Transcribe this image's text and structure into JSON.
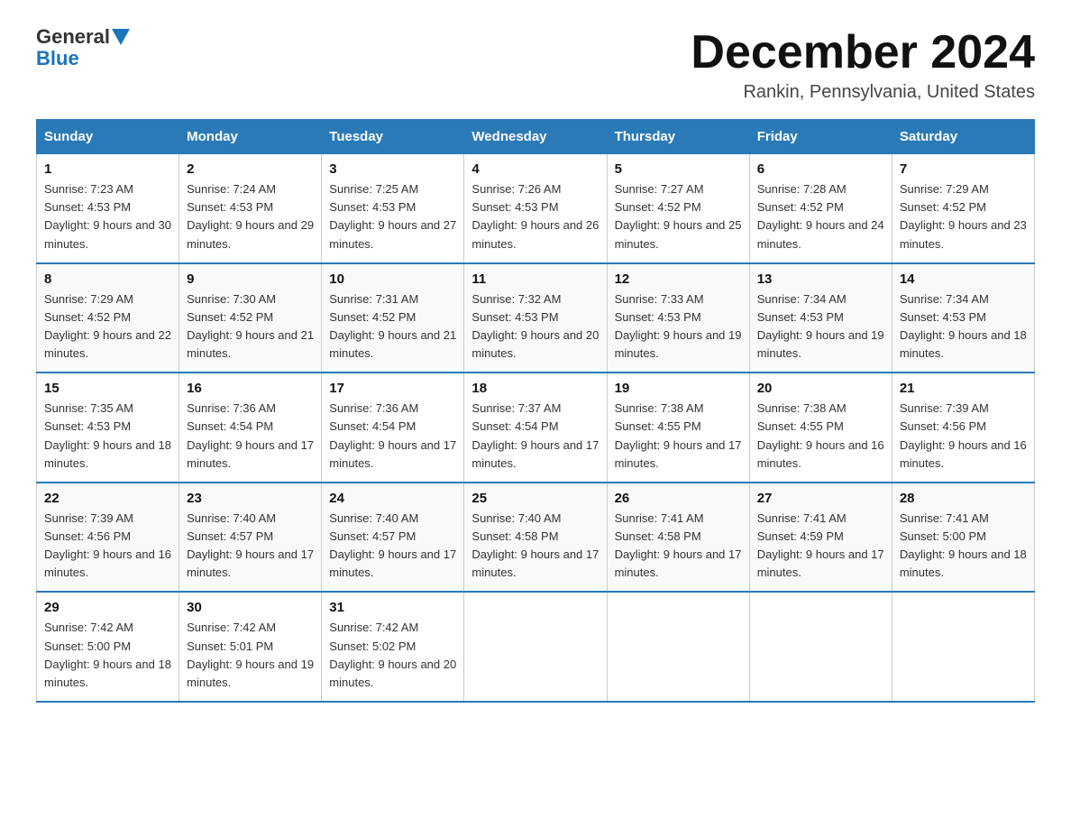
{
  "logo": {
    "general": "General",
    "blue": "Blue"
  },
  "title": "December 2024",
  "location": "Rankin, Pennsylvania, United States",
  "days_of_week": [
    "Sunday",
    "Monday",
    "Tuesday",
    "Wednesday",
    "Thursday",
    "Friday",
    "Saturday"
  ],
  "weeks": [
    [
      {
        "day": "1",
        "sunrise": "7:23 AM",
        "sunset": "4:53 PM",
        "daylight": "9 hours and 30 minutes."
      },
      {
        "day": "2",
        "sunrise": "7:24 AM",
        "sunset": "4:53 PM",
        "daylight": "9 hours and 29 minutes."
      },
      {
        "day": "3",
        "sunrise": "7:25 AM",
        "sunset": "4:53 PM",
        "daylight": "9 hours and 27 minutes."
      },
      {
        "day": "4",
        "sunrise": "7:26 AM",
        "sunset": "4:53 PM",
        "daylight": "9 hours and 26 minutes."
      },
      {
        "day": "5",
        "sunrise": "7:27 AM",
        "sunset": "4:52 PM",
        "daylight": "9 hours and 25 minutes."
      },
      {
        "day": "6",
        "sunrise": "7:28 AM",
        "sunset": "4:52 PM",
        "daylight": "9 hours and 24 minutes."
      },
      {
        "day": "7",
        "sunrise": "7:29 AM",
        "sunset": "4:52 PM",
        "daylight": "9 hours and 23 minutes."
      }
    ],
    [
      {
        "day": "8",
        "sunrise": "7:29 AM",
        "sunset": "4:52 PM",
        "daylight": "9 hours and 22 minutes."
      },
      {
        "day": "9",
        "sunrise": "7:30 AM",
        "sunset": "4:52 PM",
        "daylight": "9 hours and 21 minutes."
      },
      {
        "day": "10",
        "sunrise": "7:31 AM",
        "sunset": "4:52 PM",
        "daylight": "9 hours and 21 minutes."
      },
      {
        "day": "11",
        "sunrise": "7:32 AM",
        "sunset": "4:53 PM",
        "daylight": "9 hours and 20 minutes."
      },
      {
        "day": "12",
        "sunrise": "7:33 AM",
        "sunset": "4:53 PM",
        "daylight": "9 hours and 19 minutes."
      },
      {
        "day": "13",
        "sunrise": "7:34 AM",
        "sunset": "4:53 PM",
        "daylight": "9 hours and 19 minutes."
      },
      {
        "day": "14",
        "sunrise": "7:34 AM",
        "sunset": "4:53 PM",
        "daylight": "9 hours and 18 minutes."
      }
    ],
    [
      {
        "day": "15",
        "sunrise": "7:35 AM",
        "sunset": "4:53 PM",
        "daylight": "9 hours and 18 minutes."
      },
      {
        "day": "16",
        "sunrise": "7:36 AM",
        "sunset": "4:54 PM",
        "daylight": "9 hours and 17 minutes."
      },
      {
        "day": "17",
        "sunrise": "7:36 AM",
        "sunset": "4:54 PM",
        "daylight": "9 hours and 17 minutes."
      },
      {
        "day": "18",
        "sunrise": "7:37 AM",
        "sunset": "4:54 PM",
        "daylight": "9 hours and 17 minutes."
      },
      {
        "day": "19",
        "sunrise": "7:38 AM",
        "sunset": "4:55 PM",
        "daylight": "9 hours and 17 minutes."
      },
      {
        "day": "20",
        "sunrise": "7:38 AM",
        "sunset": "4:55 PM",
        "daylight": "9 hours and 16 minutes."
      },
      {
        "day": "21",
        "sunrise": "7:39 AM",
        "sunset": "4:56 PM",
        "daylight": "9 hours and 16 minutes."
      }
    ],
    [
      {
        "day": "22",
        "sunrise": "7:39 AM",
        "sunset": "4:56 PM",
        "daylight": "9 hours and 16 minutes."
      },
      {
        "day": "23",
        "sunrise": "7:40 AM",
        "sunset": "4:57 PM",
        "daylight": "9 hours and 17 minutes."
      },
      {
        "day": "24",
        "sunrise": "7:40 AM",
        "sunset": "4:57 PM",
        "daylight": "9 hours and 17 minutes."
      },
      {
        "day": "25",
        "sunrise": "7:40 AM",
        "sunset": "4:58 PM",
        "daylight": "9 hours and 17 minutes."
      },
      {
        "day": "26",
        "sunrise": "7:41 AM",
        "sunset": "4:58 PM",
        "daylight": "9 hours and 17 minutes."
      },
      {
        "day": "27",
        "sunrise": "7:41 AM",
        "sunset": "4:59 PM",
        "daylight": "9 hours and 17 minutes."
      },
      {
        "day": "28",
        "sunrise": "7:41 AM",
        "sunset": "5:00 PM",
        "daylight": "9 hours and 18 minutes."
      }
    ],
    [
      {
        "day": "29",
        "sunrise": "7:42 AM",
        "sunset": "5:00 PM",
        "daylight": "9 hours and 18 minutes."
      },
      {
        "day": "30",
        "sunrise": "7:42 AM",
        "sunset": "5:01 PM",
        "daylight": "9 hours and 19 minutes."
      },
      {
        "day": "31",
        "sunrise": "7:42 AM",
        "sunset": "5:02 PM",
        "daylight": "9 hours and 20 minutes."
      },
      null,
      null,
      null,
      null
    ]
  ],
  "labels": {
    "sunrise": "Sunrise:",
    "sunset": "Sunset:",
    "daylight": "Daylight:"
  }
}
